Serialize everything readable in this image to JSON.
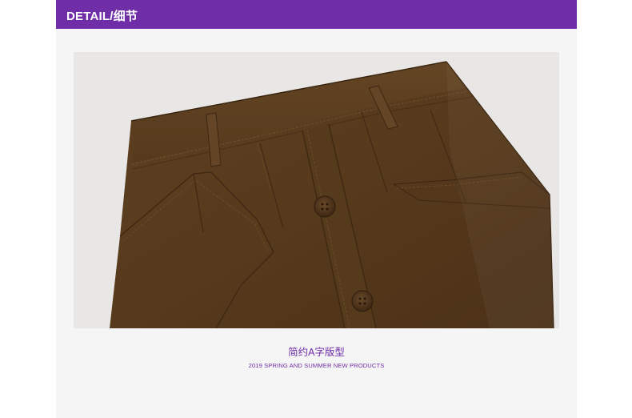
{
  "header": {
    "title": "DETAIL/细节"
  },
  "product_image": {
    "subject": "brown A-line skirt front button detail"
  },
  "caption": {
    "title": "简约A字版型",
    "subtitle": "2019 SPRING AND SUMMER NEW PRODUCTS"
  },
  "colors": {
    "accent": "#6f2da8",
    "fabric": "#5a3c1e",
    "background": "#e8e7e5"
  }
}
